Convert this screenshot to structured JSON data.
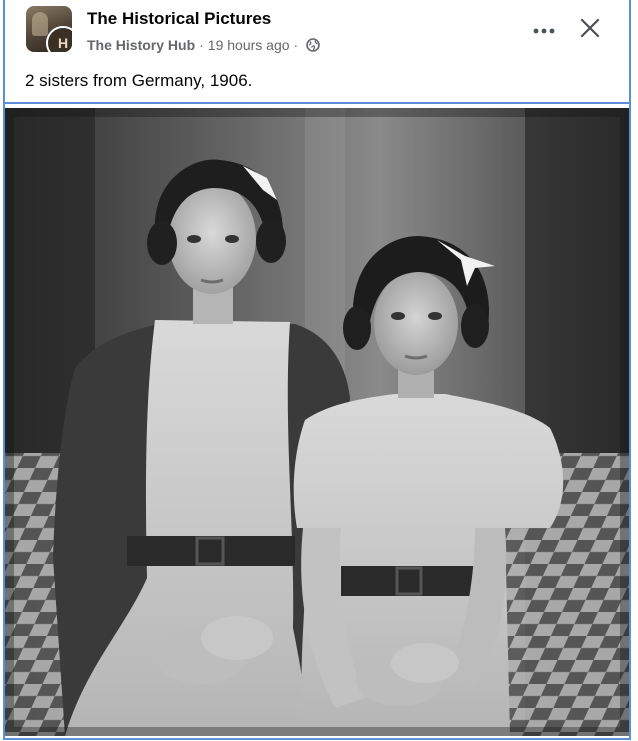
{
  "post": {
    "page_name": "The Historical Pictures",
    "group_name": "The History Hub",
    "separator": "·",
    "timestamp": "19 hours ago",
    "audience_icon": "globe-icon",
    "caption": "2 sisters from Germany, 1906.",
    "avatar_letter": "H"
  },
  "actions": {
    "more_icon": "more-options-icon",
    "close_icon": "close-icon"
  },
  "colors": {
    "frame_border": "#5b8fd8",
    "text_primary": "#050505",
    "text_secondary": "#65676b"
  }
}
